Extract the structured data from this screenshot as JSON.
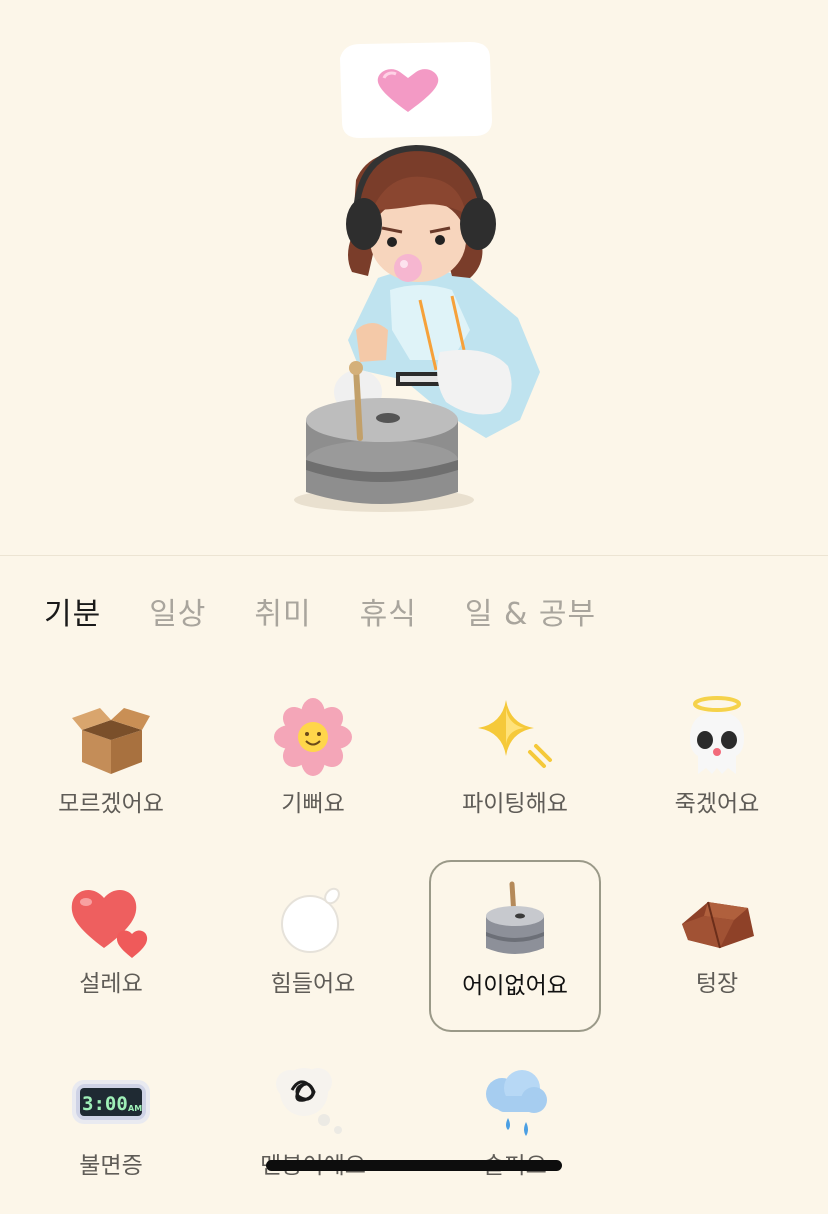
{
  "tabs": [
    {
      "label": "기분",
      "active": true
    },
    {
      "label": "일상",
      "active": false
    },
    {
      "label": "취미",
      "active": false
    },
    {
      "label": "휴식",
      "active": false
    },
    {
      "label": "일 & 공부",
      "active": false
    }
  ],
  "moods": [
    {
      "label": "모르겠어요",
      "icon": "open-box-icon"
    },
    {
      "label": "기뻐요",
      "icon": "smiling-flower-icon"
    },
    {
      "label": "파이팅해요",
      "icon": "sparkle-star-icon"
    },
    {
      "label": "죽겠어요",
      "icon": "angel-skull-icon"
    },
    {
      "label": "설레요",
      "icon": "hearts-icon"
    },
    {
      "label": "힘들어요",
      "icon": "bubble-icon"
    },
    {
      "label": "어이없어요",
      "icon": "millstone-icon",
      "selected": true
    },
    {
      "label": "텅장",
      "icon": "empty-wallet-icon"
    },
    {
      "label": "불면증",
      "icon": "alarm-clock-icon",
      "clock_text": "3:00",
      "clock_suffix": "AM"
    },
    {
      "label": "멘붕이에요",
      "icon": "scribble-thought-icon"
    },
    {
      "label": "슬퍼요",
      "icon": "rain-cloud-icon"
    }
  ],
  "colors": {
    "background": "#fcf6e9",
    "active_tab": "#1a1a1a",
    "inactive_tab": "#a9a59d",
    "selected_border": "#9a9988"
  }
}
